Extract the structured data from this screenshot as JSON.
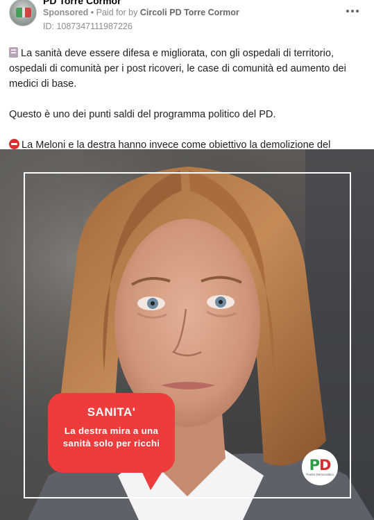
{
  "header": {
    "page_name": "PD Torre Cormor",
    "sponsored_label": "Sponsored",
    "separator": " • ",
    "paid_for_prefix": "Paid for by ",
    "payer": "Circoli PD Torre Cormor",
    "ad_id": "ID: 1087347111987226",
    "more_icon": "more-horizontal-icon"
  },
  "post": {
    "paragraph_1": "La sanità deve essere difesa e migliorata, con gli ospedali di territorio, ospedali di comunità per i post ricoveri, le case di comunità ed aumento dei medici di base.",
    "paragraph_2": "Questo è uno dei punti saldi del programma politico del PD.",
    "paragraph_3": "La Meloni e la destra hanno invece come obiettivo la demolizione del sistema sanitario pubblico a favore del privato (si veda il sistema Lombardia, soprattutto…",
    "emoji_1": "memo-icon",
    "emoji_2": "no-entry-icon"
  },
  "ad_image": {
    "bubble_title": "SANITA'",
    "bubble_text": "La destra mira a una sanità solo per ricchi",
    "logo_p": "P",
    "logo_d": "D",
    "logo_caption": "Partito Democratico",
    "accent_red": "#ee3b3b",
    "logo_green": "#2f9b47"
  }
}
